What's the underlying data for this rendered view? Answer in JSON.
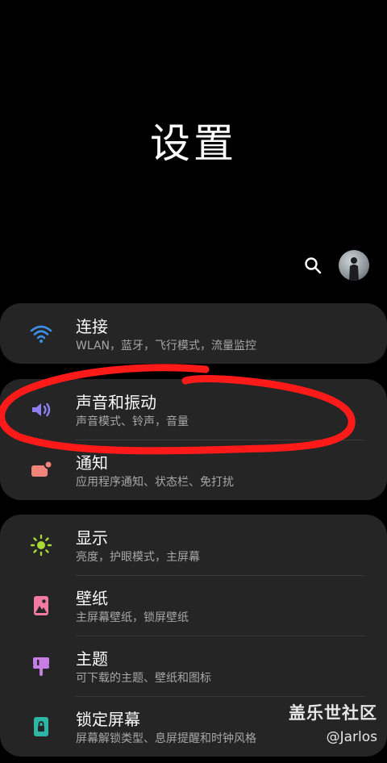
{
  "page_title": "设置",
  "header": {
    "search_icon": "search-icon",
    "avatar": "avatar"
  },
  "cards": [
    {
      "items": [
        {
          "icon": "wifi-icon",
          "title": "连接",
          "subtitle": "WLAN，蓝牙，飞行模式，流量监控"
        }
      ]
    },
    {
      "items": [
        {
          "icon": "volume-icon",
          "title": "声音和振动",
          "subtitle": "声音模式、铃声，音量"
        },
        {
          "icon": "notification-icon",
          "title": "通知",
          "subtitle": "应用程序通知、状态栏、免打扰"
        }
      ]
    },
    {
      "items": [
        {
          "icon": "brightness-icon",
          "title": "显示",
          "subtitle": "亮度，护眼模式，主屏幕"
        },
        {
          "icon": "wallpaper-icon",
          "title": "壁纸",
          "subtitle": "主屏幕壁纸，锁屏壁纸"
        },
        {
          "icon": "theme-brush-icon",
          "title": "主题",
          "subtitle": "可下载的主题、壁纸和图标"
        },
        {
          "icon": "lock-icon",
          "title": "锁定屏幕",
          "subtitle": "屏幕解锁类型、息屏提醒和时钟风格"
        }
      ]
    }
  ],
  "watermark": {
    "brand": "盖乐世社区",
    "user": "@Jarlos"
  },
  "colors": {
    "background": "#000000",
    "card": "#252525",
    "wifi": "#3b8fe8",
    "volume": "#8d7ff0",
    "notification": "#f0837a",
    "display": "#a9d936",
    "wallpaper": "#f07aa2",
    "theme": "#c77de6",
    "lock": "#2fb5a5",
    "annotation": "#ff1a1a"
  }
}
